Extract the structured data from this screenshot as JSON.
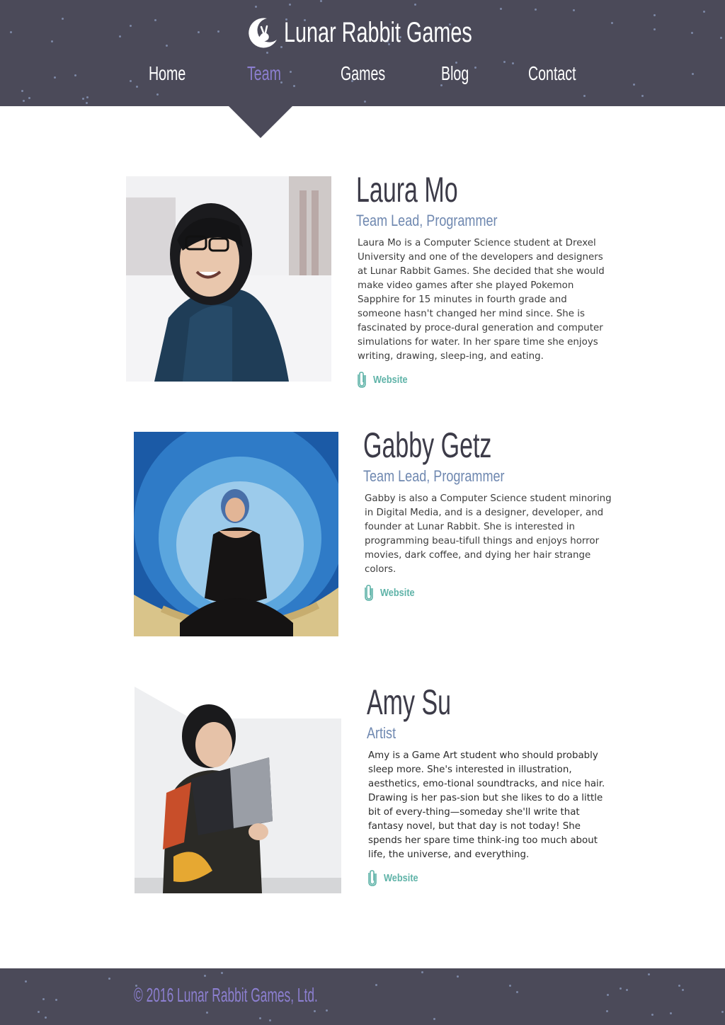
{
  "site": {
    "title": "Lunar Rabbit Games"
  },
  "nav": {
    "items": [
      {
        "label": "Home",
        "active": false
      },
      {
        "label": "Team",
        "active": true
      },
      {
        "label": "Games",
        "active": false
      },
      {
        "label": "Blog",
        "active": false
      },
      {
        "label": "Contact",
        "active": false
      }
    ]
  },
  "members": [
    {
      "name": "Laura Mo",
      "role": "Team Lead, Programmer",
      "bio": "Laura Mo is a Computer Science student at Drexel University and one of the developers and designers at Lunar Rabbit Games. She decided that she would make video games after she played Pokemon Sapphire for 15 minutes in fourth grade and someone hasn't changed her mind since. She is fascinated by proce-dural generation and computer simulations for water. In her spare time she enjoys writing, drawing, sleep-ing, and eating.",
      "link_label": "Website"
    },
    {
      "name": "Gabby Getz",
      "role": "Team Lead, Programmer",
      "bio": "Gabby is also a Computer Science student minoring in Digital Media, and is a designer, developer, and founder at Lunar Rabbit. She is interested in programming beau-tifull things and enjoys horror movies, dark coffee, and dying her hair strange colors.",
      "link_label": "Website"
    },
    {
      "name": "Amy Su",
      "role": "Artist",
      "bio": "Amy is a Game Art student who should probably sleep more. She's interested in illustration, aesthetics, emo-tional soundtracks, and nice hair. Drawing is her pas-sion but she likes to do a little bit of every-thing—someday she'll write that fantasy novel, but that day is not today! She spends her spare time think-ing too much about life, the universe, and everything.",
      "link_label": "Website"
    }
  ],
  "footer": {
    "copyright": "© 2016 Lunar Rabbit Games, Ltd."
  },
  "colors": {
    "header_bg": "#4b4a59",
    "nav_active": "#8c7fd0",
    "role": "#6f88b0",
    "link": "#5fb3a8",
    "name": "#3c3b48"
  },
  "icons": {
    "logo": "moon-rabbit-icon",
    "link": "paperclip-icon"
  }
}
